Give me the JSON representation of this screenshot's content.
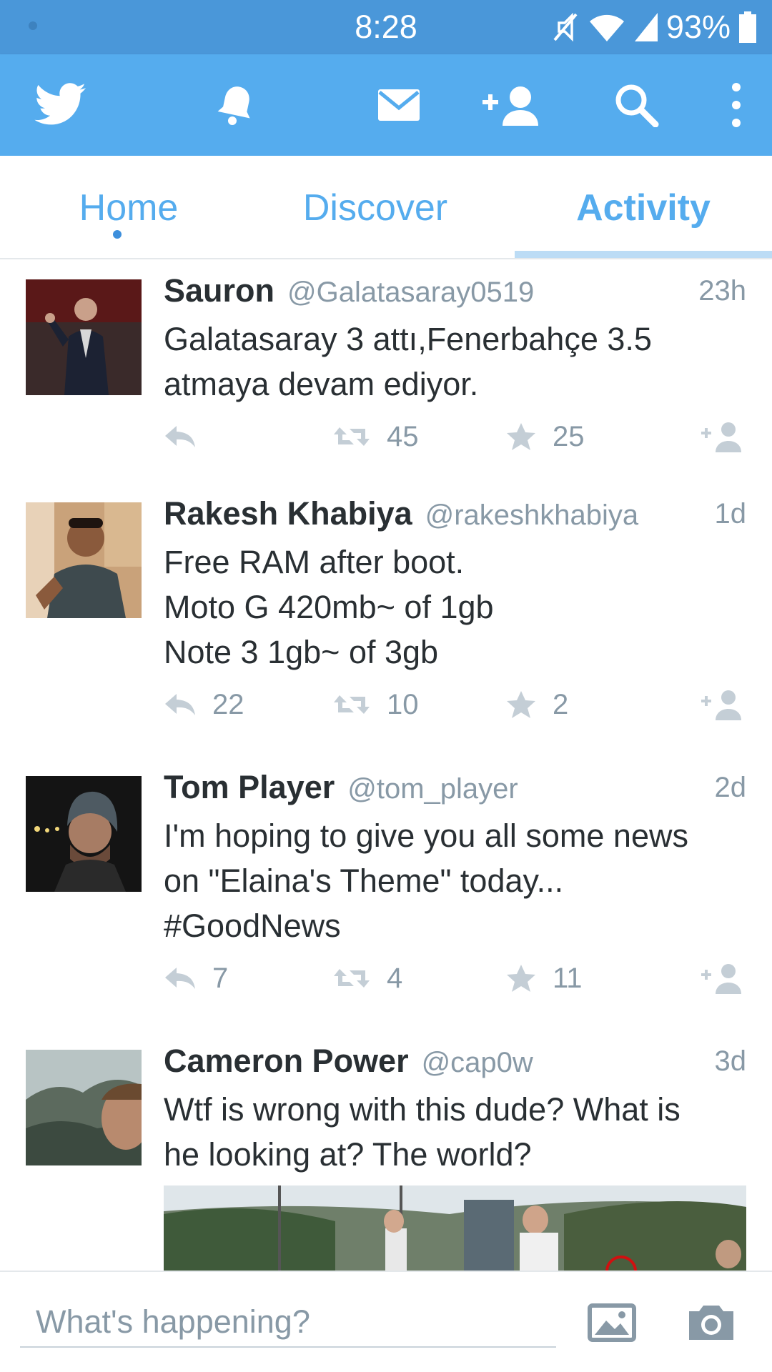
{
  "status_bar": {
    "time": "8:28",
    "battery": "93%"
  },
  "app_bar": {
    "icons": [
      "twitter-bird-icon",
      "bell-icon",
      "envelope-icon",
      "add-user-icon",
      "search-icon",
      "overflow-menu-icon"
    ]
  },
  "tabs": [
    {
      "label": "Home"
    },
    {
      "label": "Discover"
    },
    {
      "label": "Activity",
      "selected": true
    }
  ],
  "tweets": [
    {
      "name": "Sauron",
      "handle": "@Galatasaray0519",
      "time": "23h",
      "text": "Galatasaray 3 attı,Fenerbahçe 3.5\natmaya devam ediyor.",
      "replies": "",
      "retweets": "45",
      "favorites": "25"
    },
    {
      "name": "Rakesh Khabiya",
      "handle": "@rakeshkhabiya",
      "time": "1d",
      "text": "Free RAM after boot.\nMoto G 420mb~ of 1gb\nNote 3 1gb~ of 3gb",
      "replies": "22",
      "retweets": "10",
      "favorites": "2"
    },
    {
      "name": "Tom Player",
      "handle": "@tom_player",
      "time": "2d",
      "text": "I'm hoping to give you all some news\non \"Elaina's Theme\" today...\n#GoodNews",
      "replies": "7",
      "retweets": "4",
      "favorites": "11"
    },
    {
      "name": "Cameron Power",
      "handle": "@cap0w",
      "time": "3d",
      "text": "Wtf is wrong with this dude? What is\nhe looking at? The world?"
    }
  ],
  "compose": {
    "placeholder": "What's happening?",
    "icons": [
      "image-icon",
      "camera-icon"
    ]
  },
  "colors": {
    "status_bar": "#4a97d9",
    "app_bar": "#55acee",
    "accent": "#55acee",
    "text": "#292f33",
    "secondary_text": "#8899a6"
  }
}
